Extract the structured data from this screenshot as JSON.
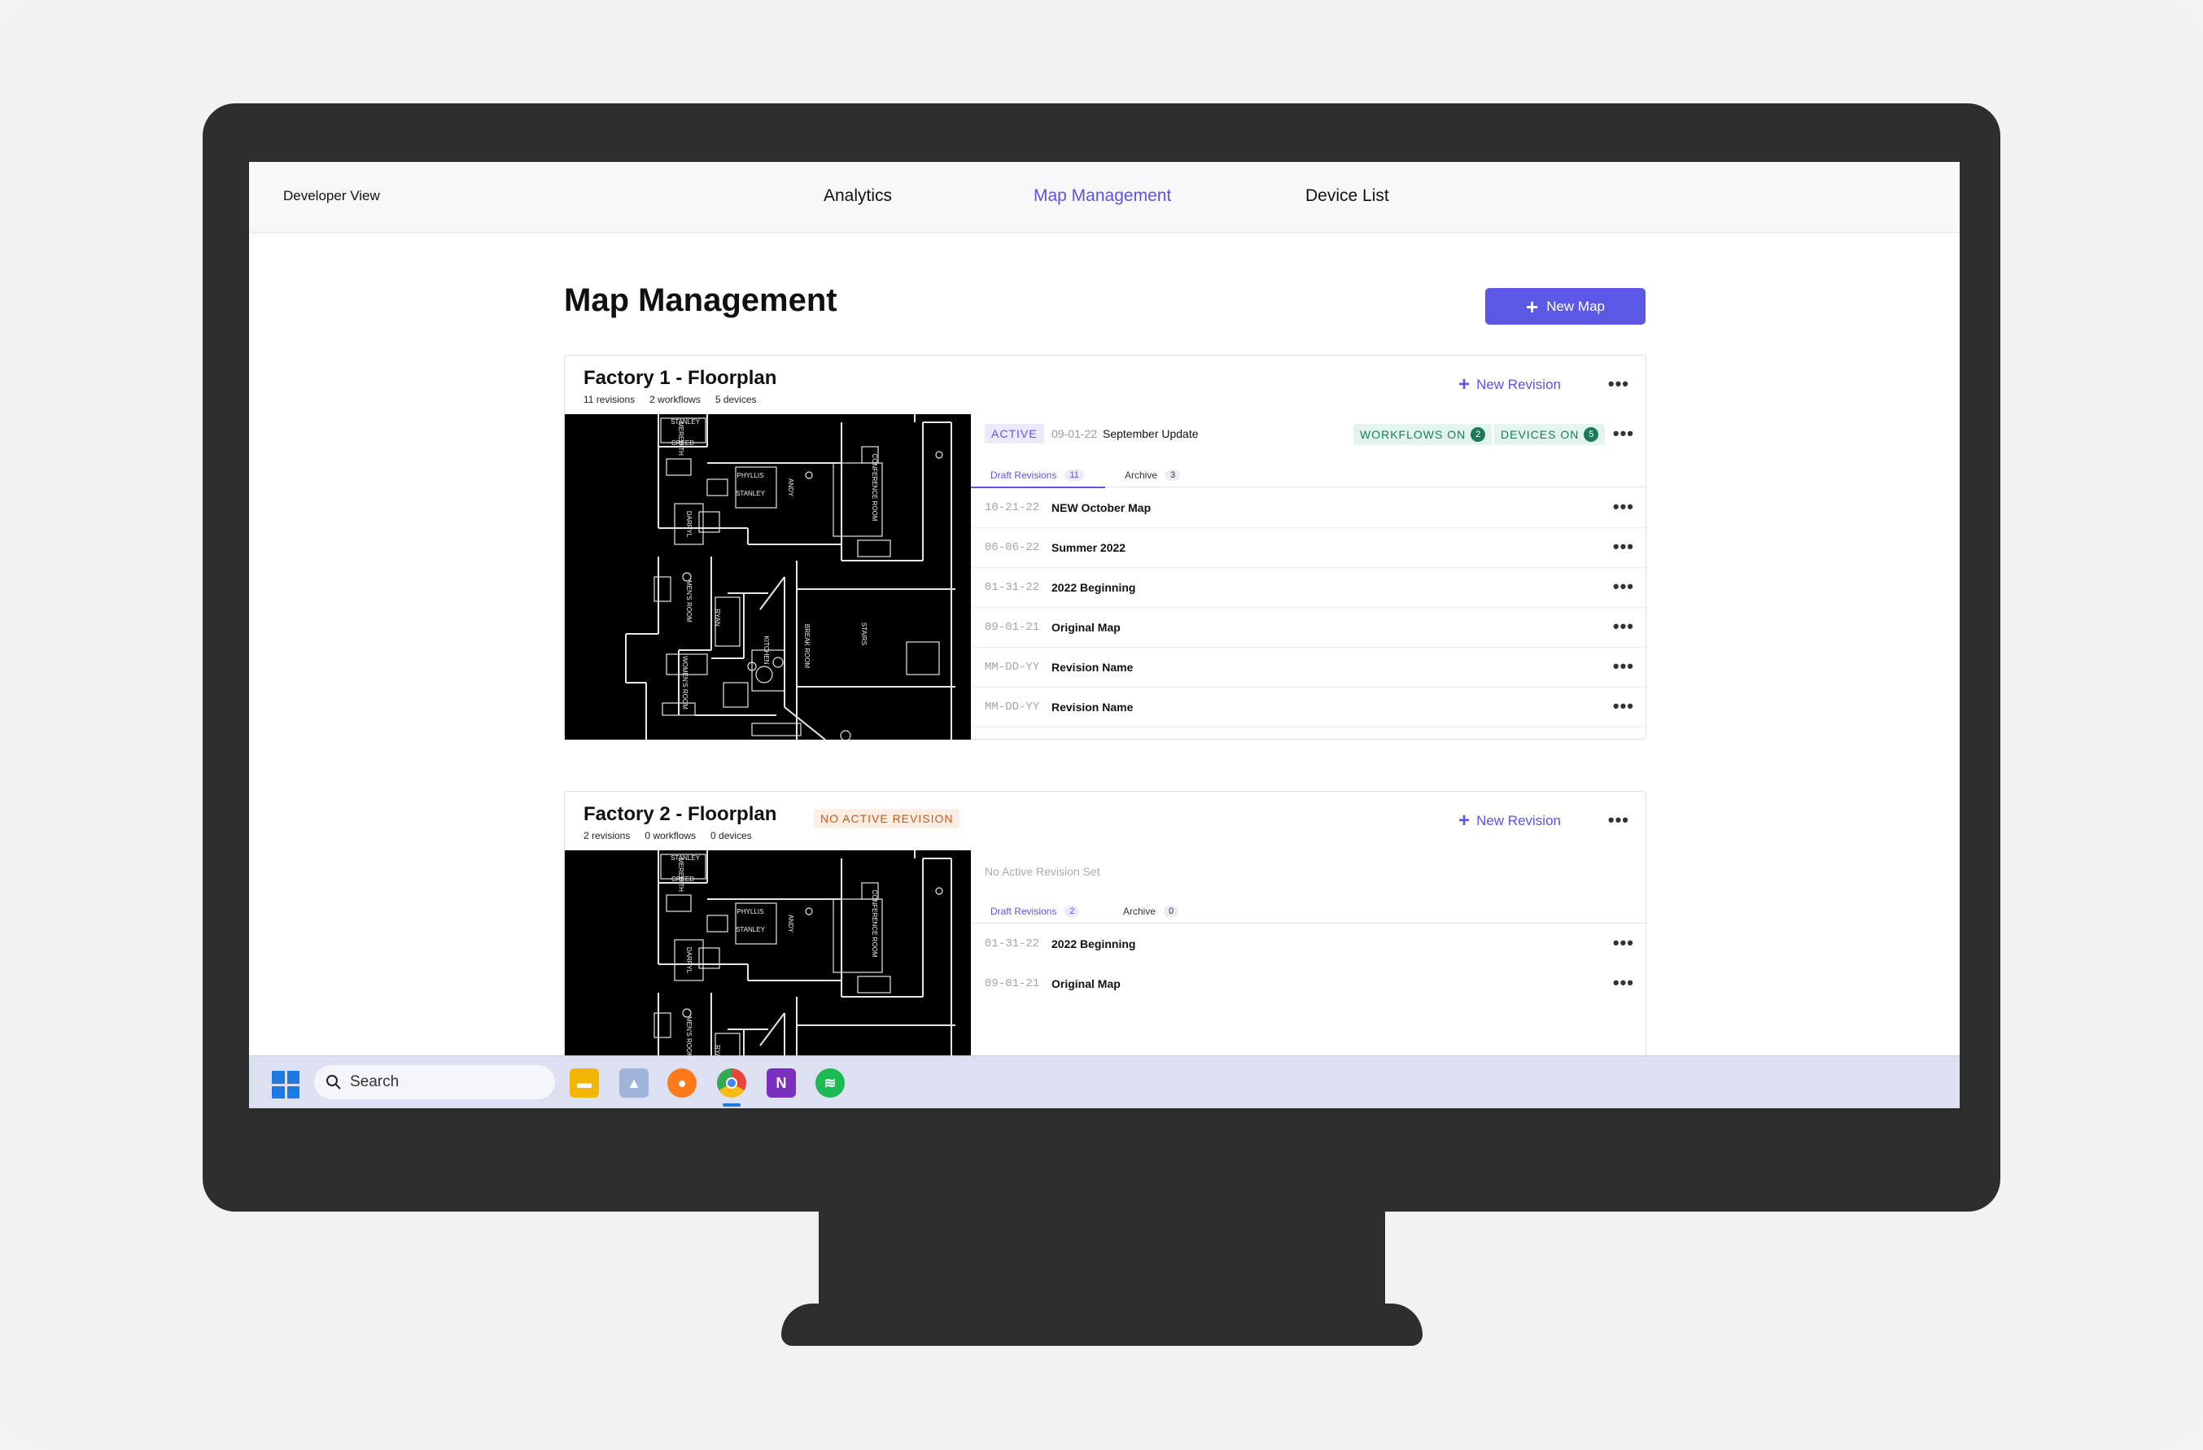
{
  "topnav": {
    "developer_view": "Developer View",
    "items": [
      {
        "label": "Analytics",
        "active": false
      },
      {
        "label": "Map Management",
        "active": true
      },
      {
        "label": "Device List",
        "active": false
      }
    ]
  },
  "page": {
    "title": "Map Management",
    "new_map_label": "New Map"
  },
  "colors": {
    "accent": "#5c58e6",
    "active_badge_bg": "#ebeafd",
    "status_green": "#1c7a5a",
    "warning_orange": "#c45a1a"
  },
  "maps": [
    {
      "title": "Factory 1 - Floorplan",
      "revisions_meta": "11 revisions",
      "workflows_meta": "2 workflows",
      "devices_meta": "5 devices",
      "new_revision_label": "New Revision",
      "active_badge": "ACTIVE",
      "active_date": "09-01-22",
      "active_name": "September Update",
      "workflows_on_label": "WORKFLOWS ON",
      "workflows_on_count": "2",
      "devices_on_label": "DEVICES ON",
      "devices_on_count": "5",
      "tab_draft_label": "Draft Revisions",
      "tab_draft_count": "11",
      "tab_archive_label": "Archive",
      "tab_archive_count": "3",
      "revisions": [
        {
          "date": "10-21-22",
          "name": "NEW October Map"
        },
        {
          "date": "06-06-22",
          "name": "Summer 2022"
        },
        {
          "date": "01-31-22",
          "name": "2022 Beginning"
        },
        {
          "date": "09-01-21",
          "name": "Original Map"
        },
        {
          "date": "MM-DD-YY",
          "name": "Revision Name"
        },
        {
          "date": "MM-DD-YY",
          "name": "Revision Name"
        }
      ]
    },
    {
      "title": "Factory 2 - Floorplan",
      "no_active_badge": "NO ACTIVE REVISION",
      "revisions_meta": "2 revisions",
      "workflows_meta": "0 workflows",
      "devices_meta": "0 devices",
      "new_revision_label": "New Revision",
      "no_active_text": "No Active Revision Set",
      "tab_draft_label": "Draft Revisions",
      "tab_draft_count": "2",
      "tab_archive_label": "Archive",
      "tab_archive_count": "0",
      "revisions": [
        {
          "date": "01-31-22",
          "name": "2022 Beginning"
        },
        {
          "date": "09-01-21",
          "name": "Original Map"
        }
      ]
    }
  ],
  "floorplan_labels": [
    "DWIGHT",
    "MEREDITH",
    "CREED",
    "CONFERENCE ROOM",
    "PHYLLIS",
    "STANLEY",
    "ANDY",
    "DARRYL",
    "MEN'S ROOM",
    "RYAN",
    "KITCHEN",
    "WOMEN'S ROOM",
    "BREAK ROOM",
    "STAIRS"
  ],
  "taskbar": {
    "search_placeholder": "Search",
    "apps": [
      "windows-start",
      "file-explorer",
      "photos",
      "firefox",
      "chrome",
      "onenote",
      "spotify"
    ]
  }
}
